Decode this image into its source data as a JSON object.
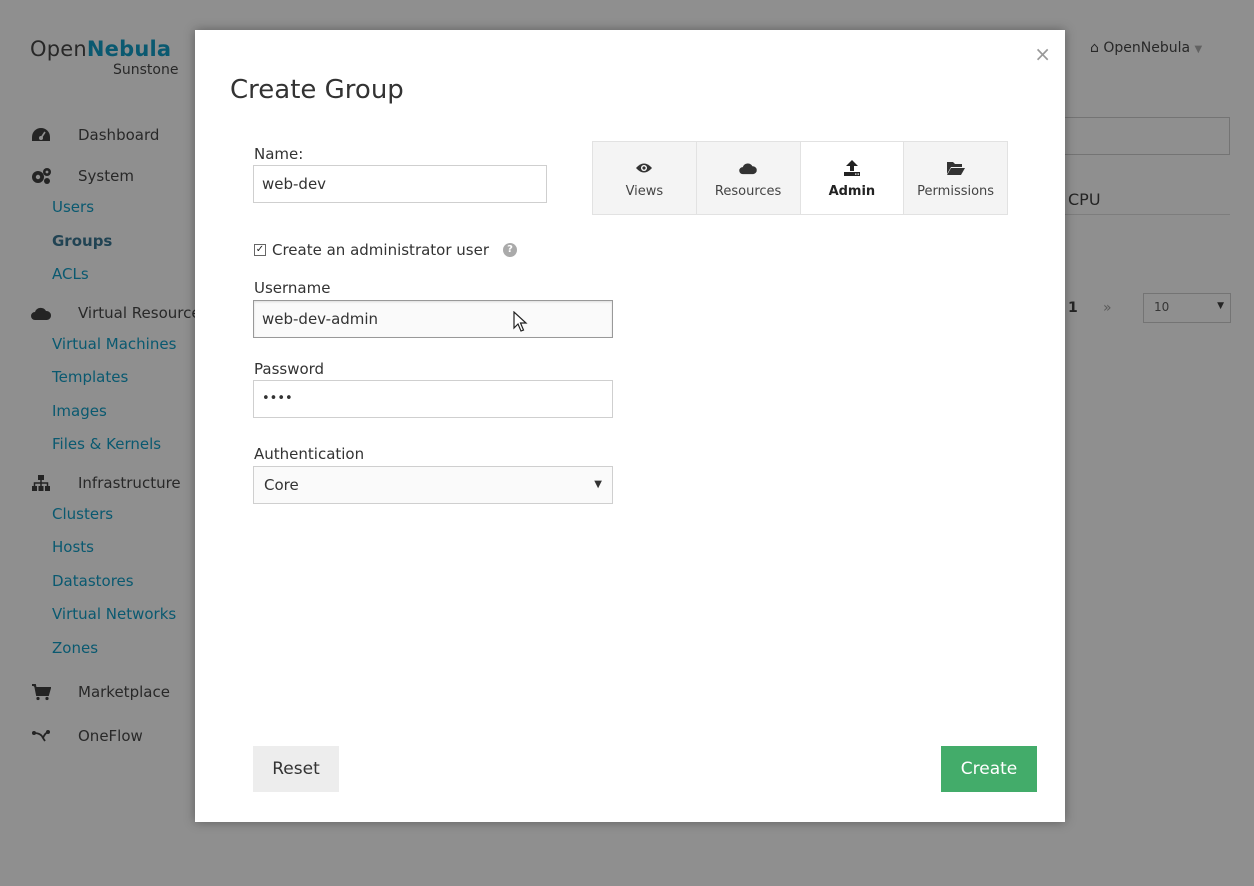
{
  "app": {
    "logo_main_a": "Open",
    "logo_main_b": "Nebula",
    "logo_sub": "Sunstone",
    "user_menu": "OpenNebula",
    "table_header_cpu": "CPU",
    "page_current": "1",
    "page_next": "»",
    "page_size": "10",
    "sidebar": {
      "dashboard": "Dashboard",
      "system": "System",
      "users": "Users",
      "groups": "Groups",
      "acls": "ACLs",
      "virtual_resources": "Virtual Resources",
      "virtual_machines": "Virtual Machines",
      "templates": "Templates",
      "images": "Images",
      "files_kernels": "Files & Kernels",
      "infrastructure": "Infrastructure",
      "clusters": "Clusters",
      "hosts": "Hosts",
      "datastores": "Datastores",
      "virtual_networks": "Virtual Networks",
      "zones": "Zones",
      "marketplace": "Marketplace",
      "oneflow": "OneFlow"
    }
  },
  "modal": {
    "title": "Create Group",
    "close": "×",
    "name_label": "Name:",
    "name_value": "web-dev",
    "create_admin_label": "Create an administrator user",
    "create_admin_checked": true,
    "help_icon": "?",
    "username_label": "Username",
    "username_value": "web-dev-admin",
    "password_label": "Password",
    "password_value": "••••",
    "auth_label": "Authentication",
    "auth_value": "Core",
    "tabs": {
      "views": "Views",
      "resources": "Resources",
      "admin": "Admin",
      "permissions": "Permissions"
    },
    "reset_button": "Reset",
    "create_button": "Create"
  },
  "colors": {
    "brand": "#0098c3",
    "create_button": "#43ac6a",
    "overlay": "rgba(20,20,20,0.48)"
  },
  "icons": {
    "dashboard": "tachometer-icon",
    "system": "cogs-icon",
    "virtual_resources": "cloud-icon",
    "infrastructure": "sitemap-icon",
    "marketplace": "shopping-cart-icon",
    "oneflow": "code-fork-icon",
    "views": "eye-icon",
    "resources": "cloud-icon",
    "admin": "upload-icon",
    "permissions": "folder-open-icon",
    "home": "home-icon"
  }
}
